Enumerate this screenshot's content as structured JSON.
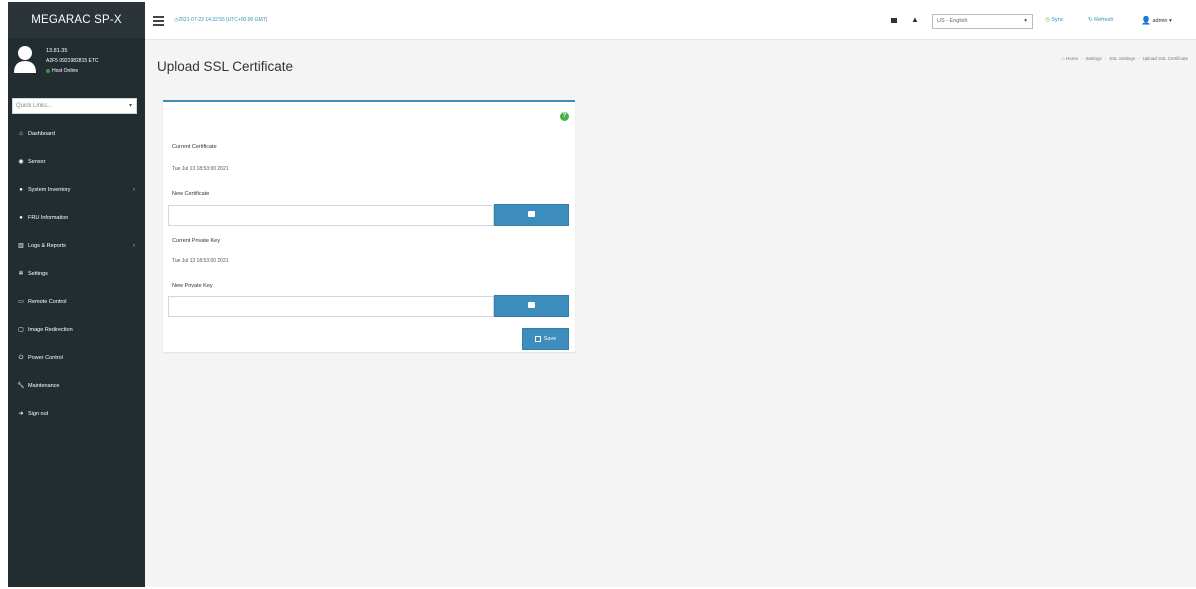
{
  "brand": "MEGARAC SP-X",
  "user": {
    "name": "13.81.35",
    "sub": "A2F5 0921982815 ETC",
    "status": "Host Online"
  },
  "quick_links": {
    "placeholder": "Quick Links..."
  },
  "menu": [
    {
      "label": "Dashboard",
      "icon": "dashboard-icon",
      "glyph": "⌂",
      "has_children": false
    },
    {
      "label": "Sensor",
      "icon": "sensor-icon",
      "glyph": "◉",
      "has_children": false
    },
    {
      "label": "System Inventory",
      "icon": "inventory-icon",
      "glyph": "●",
      "has_children": true
    },
    {
      "label": "FRU Information",
      "icon": "fru-icon",
      "glyph": "●",
      "has_children": false
    },
    {
      "label": "Logs & Reports",
      "icon": "logs-icon",
      "glyph": "▥",
      "has_children": true
    },
    {
      "label": "Settings",
      "icon": "settings-icon",
      "glyph": "✲",
      "has_children": false
    },
    {
      "label": "Remote Control",
      "icon": "remote-control-icon",
      "glyph": "▭",
      "has_children": false
    },
    {
      "label": "Image Redirection",
      "icon": "image-redirection-icon",
      "glyph": "▢",
      "has_children": false
    },
    {
      "label": "Power Control",
      "icon": "power-icon",
      "glyph": "⏻",
      "has_children": false
    },
    {
      "label": "Maintenance",
      "icon": "wrench-icon",
      "glyph": "🔧",
      "has_children": false
    },
    {
      "label": "Sign out",
      "icon": "signout-icon",
      "glyph": "➜",
      "has_children": false
    }
  ],
  "topbar": {
    "datetime": "2021-07-22 14:32:55 [UTC+00:00 GMT]",
    "language": "US - English",
    "sync_label": "Sync",
    "refresh_label": "Refresh",
    "admin_label": "admin"
  },
  "page": {
    "title": "Upload SSL Certificate",
    "breadcrumb": [
      "Home",
      "Settings",
      "SSL Settings",
      "Upload SSL Certificate"
    ]
  },
  "form": {
    "current_certificate_label": "Current Certificate",
    "current_certificate_value": "Tue Jul 13 18:53:00 2021",
    "new_certificate_label": "New Certificate",
    "current_private_key_label": "Current Private Key",
    "current_private_key_value": "Tue Jul 13 18:53:00 2021",
    "new_private_key_label": "New Private Key",
    "save_label": "Save"
  },
  "colors": {
    "sidebar": "#222d32",
    "accent": "#3c8dbc",
    "online": "#3c9a3c",
    "help": "#4caf50"
  }
}
